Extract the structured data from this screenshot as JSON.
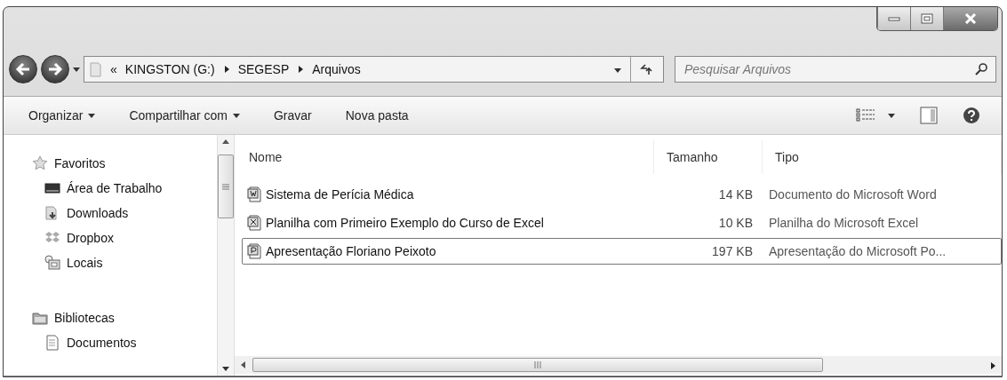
{
  "address": {
    "overflow": "«",
    "segments": [
      "KINGSTON (G:)",
      "SEGESP",
      "Arquivos"
    ]
  },
  "search": {
    "placeholder": "Pesquisar Arquivos"
  },
  "toolbar": {
    "buttons": [
      {
        "label": "Organizar",
        "dropdown": true
      },
      {
        "label": "Compartilhar com",
        "dropdown": true
      },
      {
        "label": "Gravar",
        "dropdown": false
      },
      {
        "label": "Nova pasta",
        "dropdown": false
      }
    ]
  },
  "sidebar": {
    "groups": [
      {
        "label": "Favoritos",
        "kind": "favorites",
        "children": [
          {
            "label": "Área de Trabalho",
            "kind": "desktop"
          },
          {
            "label": "Downloads",
            "kind": "downloads"
          },
          {
            "label": "Dropbox",
            "kind": "dropbox"
          },
          {
            "label": "Locais",
            "kind": "places"
          }
        ]
      },
      {
        "label": "Bibliotecas",
        "kind": "libraries",
        "children": [
          {
            "label": "Documentos",
            "kind": "documents"
          }
        ]
      }
    ]
  },
  "table": {
    "columns": [
      "Nome",
      "Tamanho",
      "Tipo"
    ],
    "rows": [
      {
        "kind": "word",
        "name": "Sistema de Perícia Médica",
        "size": "14 KB",
        "type": "Documento do Microsoft Word",
        "selected": false
      },
      {
        "kind": "excel",
        "name": "Planilha com Primeiro Exemplo do Curso de Excel",
        "size": "10 KB",
        "type": "Planilha do Microsoft Excel",
        "selected": false
      },
      {
        "kind": "powerpoint",
        "name": "Apresentação Floriano Peixoto",
        "size": "197 KB",
        "type": "Apresentação do Microsoft Po...",
        "selected": true
      }
    ]
  }
}
